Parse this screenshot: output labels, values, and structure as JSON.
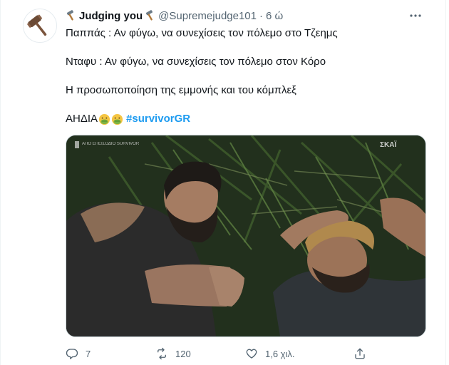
{
  "tweet": {
    "display_name": "Judging you",
    "handle": "@Supremejudge101",
    "separator": "·",
    "time": "6 ώ",
    "lines": [
      "Παππάς : Αν φύγω, να συνεχίσεις τον πόλεμο στο Τζεημς",
      "Νταφυ : Αν φύγω, να συνεχίσεις τον πόλεμο στον Κόρο",
      "Η προσωποποίηση της εμμονής και του κόμπλεξ"
    ],
    "last_line_text": "ΑΗΔΙΑ",
    "hashtag": "#survivorGR"
  },
  "media": {
    "overlay_left": "ΑΠΟ ΕΠΕΙΣΟΔΙΟ SURVIVOR",
    "overlay_right": "ΣΚΑΪ"
  },
  "actions": {
    "replies": "7",
    "retweets": "120",
    "likes": "1,6 χιλ."
  },
  "icons": {
    "name_decoration": "hammer-emoji",
    "reaction_emoji": "nauseated-face-emoji",
    "avatar": "gavel-icon",
    "more": "ellipsis-icon",
    "reply": "reply-icon",
    "retweet": "retweet-icon",
    "like": "heart-icon",
    "share": "share-icon"
  },
  "colors": {
    "accent": "#1d9bf0",
    "secondary_text": "#536471",
    "primary_text": "#0f1419"
  }
}
